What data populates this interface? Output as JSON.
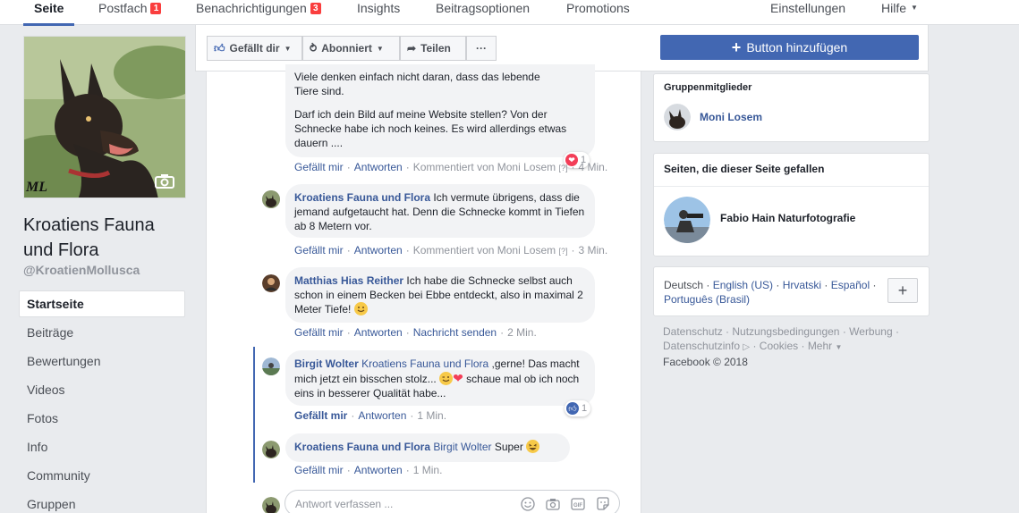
{
  "topnav": {
    "items": [
      {
        "label": "Seite",
        "badge": ""
      },
      {
        "label": "Postfach",
        "badge": "1"
      },
      {
        "label": "Benachrichtigungen",
        "badge": "3"
      },
      {
        "label": "Insights",
        "badge": ""
      },
      {
        "label": "Beitragsoptionen",
        "badge": ""
      },
      {
        "label": "Promotions",
        "badge": ""
      }
    ],
    "settings": "Einstellungen",
    "help": "Hilfe"
  },
  "profile": {
    "watermark": "ML",
    "name": "Kroatiens Fauna und Flora",
    "handle": "@KroatienMollusca"
  },
  "left_nav": [
    "Startseite",
    "Beiträge",
    "Bewertungen",
    "Videos",
    "Fotos",
    "Info",
    "Community",
    "Gruppen"
  ],
  "actions": {
    "like": "Gefällt dir",
    "follow": "Abonniert",
    "share": "Teilen",
    "more": "···",
    "add_button": "Button hinzufügen"
  },
  "comments": [
    {
      "lines_a": "Viele denken einfach nicht daran, dass das lebende Tiere sind.",
      "lines_b": "Darf ich dein Bild auf meine Website stellen? Von der Schnecke habe ich noch keines. Es wird allerdings etwas dauern ....",
      "reaction_count": "1",
      "meta_like": "Gefällt mir",
      "meta_reply": "Antworten",
      "meta_extra": "Kommentiert von Moni Losem",
      "meta_q": "[?]",
      "meta_time": "4 Min."
    },
    {
      "author": "Kroatiens Fauna und Flora",
      "text": "Ich vermute übrigens, dass die jemand aufgetaucht hat. Denn die Schnecke kommt in Tiefen ab 8 Metern vor.",
      "meta_like": "Gefällt mir",
      "meta_reply": "Antworten",
      "meta_extra": "Kommentiert von Moni Losem",
      "meta_q": "[?]",
      "meta_time": "3 Min."
    },
    {
      "author": "Matthias Hias Reither",
      "text": "Ich habe die Schnecke selbst auch schon in einem Becken bei Ebbe entdeckt, also in maximal 2 Meter Tiefe!",
      "meta_like": "Gefällt mir",
      "meta_reply": "Antworten",
      "meta_extra": "Nachricht senden",
      "meta_time": "2 Min."
    },
    {
      "author": "Birgit Wolter",
      "mention": "Kroatiens Fauna und Flora",
      "text_a": " ,gerne! Das macht mich jetzt ein bisschen stolz...",
      "text_b": " schaue mal ob ich noch eins in besserer Qualität habe...",
      "reaction_count": "1",
      "meta_like": "Gefällt mir",
      "meta_reply": "Antworten",
      "meta_time": "1 Min."
    },
    {
      "author": "Kroatiens Fauna und Flora",
      "mention": "Birgit Wolter",
      "text": " Super",
      "meta_like": "Gefällt mir",
      "meta_reply": "Antworten",
      "meta_time": "1 Min."
    }
  ],
  "reply": {
    "placeholder": "Antwort verfassen ..."
  },
  "right": {
    "members_title": "Gruppenmitglieder",
    "member_name": "Moni Losem",
    "liked_title": "Seiten, die dieser Seite gefallen",
    "liked_page": "Fabio Hain Naturfotografie",
    "languages": [
      "Deutsch",
      "English (US)",
      "Hrvatski",
      "Español",
      "Português (Brasil)"
    ],
    "footer_links": [
      "Datenschutz",
      "Nutzungsbedingungen",
      "Werbung",
      "Datenschutzinfo",
      "Cookies",
      "Mehr"
    ],
    "copyright": "Facebook © 2018"
  },
  "colors": {
    "brand": "#4267b2",
    "link": "#385898",
    "badge": "#fa3e3e",
    "love": "#f33e58"
  }
}
